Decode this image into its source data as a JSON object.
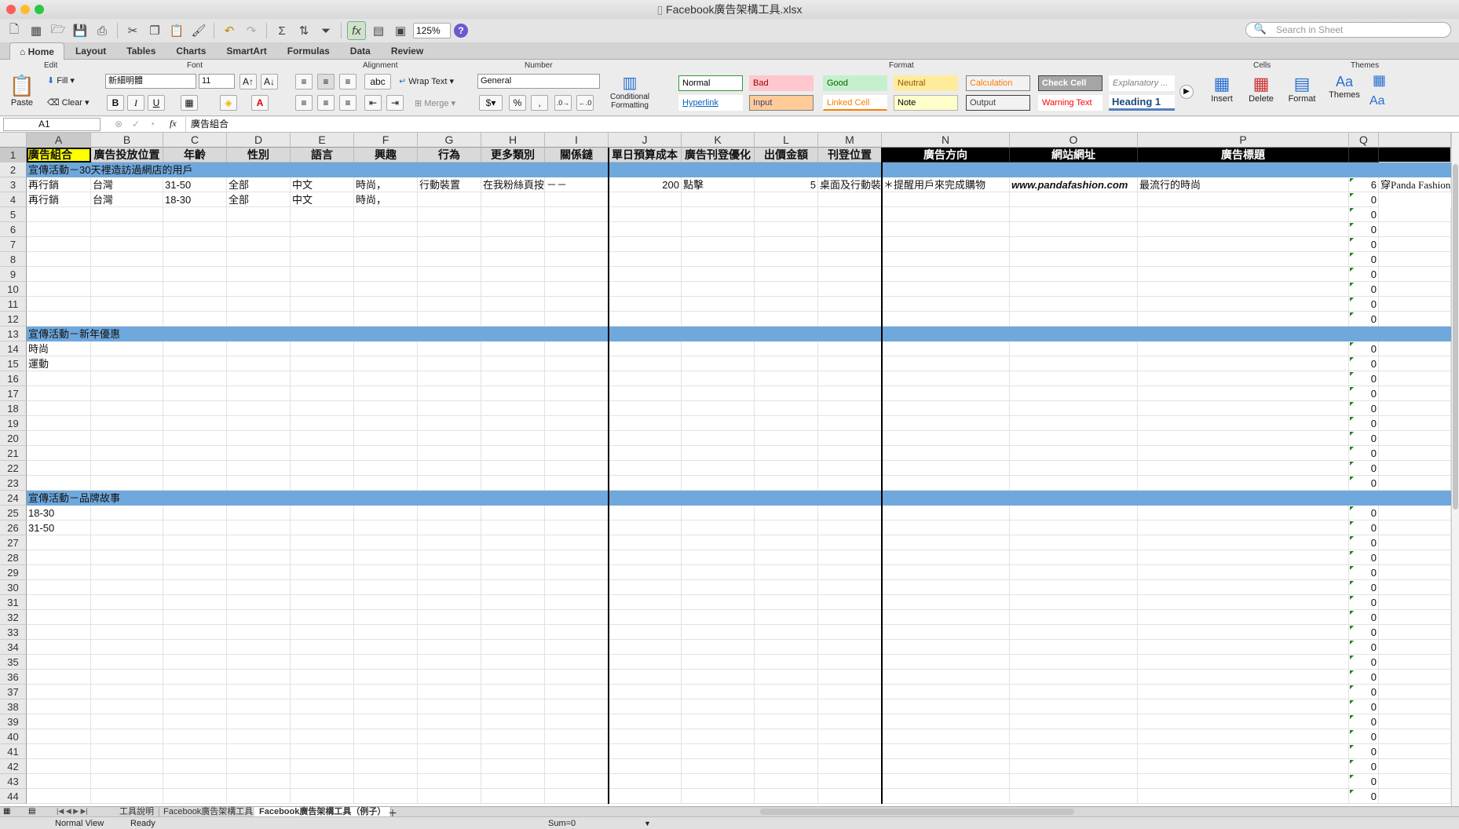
{
  "window": {
    "title": "Facebook廣告架構工具.xlsx"
  },
  "toolbar": {
    "zoom": "125%",
    "search_placeholder": "Search in Sheet"
  },
  "ribbon_tabs": [
    "Home",
    "Layout",
    "Tables",
    "Charts",
    "SmartArt",
    "Formulas",
    "Data",
    "Review"
  ],
  "ribbon": {
    "edit": {
      "label": "Edit",
      "paste": "Paste",
      "fill": "Fill",
      "clear": "Clear"
    },
    "font": {
      "label": "Font",
      "name": "新細明體",
      "size": "11",
      "bold": "B",
      "italic": "I",
      "underline": "U"
    },
    "alignment": {
      "label": "Alignment",
      "wrap": "Wrap Text",
      "merge": "Merge",
      "abc": "abc"
    },
    "number": {
      "label": "Number",
      "format": "General",
      "percent": "%",
      "comma": ","
    },
    "conditional": "Conditional Formatting",
    "format": {
      "label": "Format",
      "styles": [
        {
          "label": "Normal",
          "bg": "#ffffff",
          "color": "#000000",
          "border": "#2f9b2f"
        },
        {
          "label": "Bad",
          "bg": "#ffc7ce",
          "color": "#9c0006",
          "border": "#ffc7ce"
        },
        {
          "label": "Good",
          "bg": "#c6efce",
          "color": "#006100",
          "border": "#c6efce"
        },
        {
          "label": "Neutral",
          "bg": "#ffeb9c",
          "color": "#9c5700",
          "border": "#ffeb9c"
        },
        {
          "label": "Calculation",
          "bg": "#f2f2f2",
          "color": "#fa7d00",
          "border": "#7f7f7f"
        },
        {
          "label": "Check Cell",
          "bg": "#a5a5a5",
          "color": "#ffffff",
          "border": "#3f3f3f"
        },
        {
          "label": "Explanatory ...",
          "bg": "#ffffff",
          "color": "#7f7f7f",
          "border": "#ffffff"
        },
        {
          "label": "Hyperlink",
          "bg": "#ffffff",
          "color": "#0563c1",
          "border": "#ffffff"
        },
        {
          "label": "Input",
          "bg": "#ffcc99",
          "color": "#3f3f76",
          "border": "#7f7f7f"
        },
        {
          "label": "Linked Cell",
          "bg": "#ffffff",
          "color": "#fa7d00",
          "border": "#ffffff"
        },
        {
          "label": "Note",
          "bg": "#ffffcc",
          "color": "#000000",
          "border": "#b2b2b2"
        },
        {
          "label": "Output",
          "bg": "#f2f2f2",
          "color": "#3f3f3f",
          "border": "#3f3f3f"
        },
        {
          "label": "Warning Text",
          "bg": "#ffffff",
          "color": "#ff0000",
          "border": "#ffffff"
        },
        {
          "label": "Heading 1",
          "bg": "#ffffff",
          "color": "#1f497d",
          "border": "#4f81bd"
        }
      ]
    },
    "cells": {
      "label": "Cells",
      "insert": "Insert",
      "delete": "Delete",
      "format": "Format"
    },
    "themes": {
      "label": "Themes",
      "themes": "Themes",
      "fonts": "Aa"
    }
  },
  "formula_bar": {
    "name_box": "A1",
    "fx": "fx",
    "content": "廣告組合"
  },
  "columns": [
    "A",
    "B",
    "C",
    "D",
    "E",
    "F",
    "G",
    "H",
    "I",
    "J",
    "K",
    "L",
    "M",
    "N",
    "O",
    "P",
    "Q"
  ],
  "header_row": [
    "廣告組合",
    "廣告投放位置",
    "年齡",
    "性別",
    "語言",
    "興趣",
    "行為",
    "更多類別",
    "關係鏈",
    "單日預算成本",
    "廣告刊登優化",
    "出價金額",
    "刊登位置",
    "廣告方向",
    "網站網址",
    "廣告標題",
    ""
  ],
  "extra_column_text": "穿Panda Fashion",
  "sections": {
    "s2": "宣傳活動－30天裡造訪過網店的用戶",
    "s13": "宣傳活動－新年優惠",
    "s24": "宣傳活動－品牌故事"
  },
  "rows": {
    "r3": [
      "再行銷",
      "台灣",
      "31-50",
      "全部",
      "中文",
      "時尚，",
      "行動裝置",
      "在我粉絲頁按",
      "－－",
      "200",
      "點擊",
      "5",
      "桌面及行動裝",
      "＊提醒用戶來完成購物",
      "www.pandafashion.com",
      "最流行的時尚",
      "6"
    ],
    "r4": [
      "再行銷",
      "台灣",
      "18-30",
      "全部",
      "中文",
      "時尚，",
      "",
      "",
      "",
      "",
      "",
      "",
      "",
      "",
      "",
      "",
      "0"
    ],
    "r14": "時尚",
    "r15": "運動",
    "r25": "18-30",
    "r26": "31-50"
  },
  "q_default": "0",
  "sheet_tabs": [
    "工具說明",
    "Facebook廣告架構工具",
    "Facebook廣告架構工具（例子）"
  ],
  "status": {
    "view": "Normal View",
    "ready": "Ready",
    "sum": "Sum=0"
  },
  "colors": {
    "section_band": "#6fa8dc",
    "selected_cell": "#ffff00",
    "dark_header": "#000000",
    "header_gray": "#d9d9d9"
  }
}
